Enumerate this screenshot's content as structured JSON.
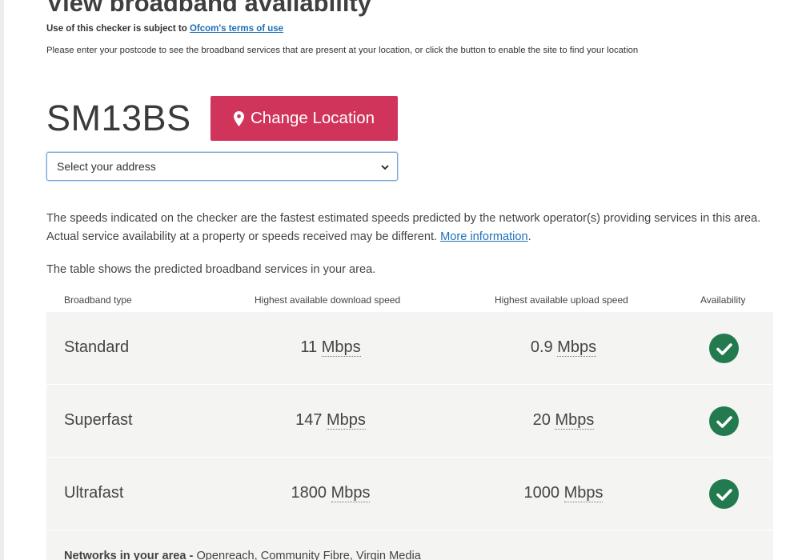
{
  "page": {
    "title": "View broadband availability",
    "terms_prefix": "Use of this checker is subject to ",
    "terms_link": "Ofcom's terms of use",
    "instructions": "Please enter your postcode to see the broadband services that are present at your location, or click the button to enable the site to find your location"
  },
  "location": {
    "postcode": "SM13BS",
    "change_button": "Change Location",
    "address_select": "Select your address"
  },
  "disclaimer": {
    "text": "The speeds indicated on the checker are the fastest estimated speeds predicted by the network operator(s) providing services in this area. Actual service availability at a property or speeds received may be different. ",
    "link": "More information",
    "suffix": "."
  },
  "table": {
    "intro": "The table shows the predicted broadband services in your area.",
    "headers": {
      "type": "Broadband type",
      "download": "Highest available download speed",
      "upload": "Highest available upload speed",
      "availability": "Availability"
    },
    "rows": [
      {
        "type": "Standard",
        "download_value": "11",
        "upload_value": "0.9",
        "unit": "Mbps",
        "available": true
      },
      {
        "type": "Superfast",
        "download_value": "147",
        "upload_value": "20",
        "unit": "Mbps",
        "available": true
      },
      {
        "type": "Ultrafast",
        "download_value": "1800",
        "upload_value": "1000",
        "unit": "Mbps",
        "available": true
      }
    ]
  },
  "networks": {
    "label": "Networks in your area - ",
    "list": "Openreach, Community Fibre, Virgin Media"
  },
  "colors": {
    "accent_button": "#d1345b",
    "check_green": "#237a4e",
    "link_blue": "#1d70b8",
    "table_bg": "#f4f4f2"
  },
  "icons": {
    "button_icon": "map-pin-icon",
    "select_icon": "chevron-down-icon",
    "availability_icon": "check-circle-icon"
  }
}
